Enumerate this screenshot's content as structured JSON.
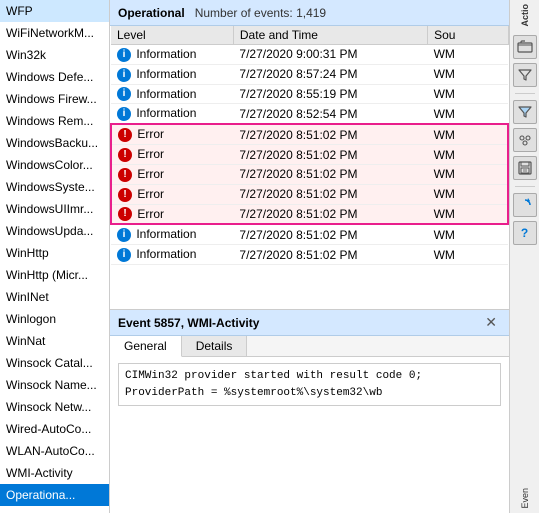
{
  "sidebar": {
    "items": [
      {
        "label": "WFP",
        "selected": false
      },
      {
        "label": "WiFiNetworkM...",
        "selected": false
      },
      {
        "label": "Win32k",
        "selected": false
      },
      {
        "label": "Windows Defe...",
        "selected": false
      },
      {
        "label": "Windows Firew...",
        "selected": false
      },
      {
        "label": "Windows Rem...",
        "selected": false
      },
      {
        "label": "WindowsBacku...",
        "selected": false
      },
      {
        "label": "WindowsColor...",
        "selected": false
      },
      {
        "label": "WindowsSyste...",
        "selected": false
      },
      {
        "label": "WindowsUIImr...",
        "selected": false
      },
      {
        "label": "WindowsUpda...",
        "selected": false
      },
      {
        "label": "WinHttp",
        "selected": false
      },
      {
        "label": "WinHttp (Micr...",
        "selected": false
      },
      {
        "label": "WinINet",
        "selected": false
      },
      {
        "label": "Winlogon",
        "selected": false
      },
      {
        "label": "WinNat",
        "selected": false
      },
      {
        "label": "Winsock Catal...",
        "selected": false
      },
      {
        "label": "Winsock Name...",
        "selected": false
      },
      {
        "label": "Winsock Netw...",
        "selected": false
      },
      {
        "label": "Wired-AutoCo...",
        "selected": false
      },
      {
        "label": "WLAN-AutoCo...",
        "selected": false
      },
      {
        "label": "WMI-Activity",
        "selected": false
      },
      {
        "label": "Operationa...",
        "selected": true
      }
    ]
  },
  "log": {
    "title": "Operational",
    "event_count": "Number of events: 1,419",
    "columns": [
      "Level",
      "Date and Time",
      "Sou"
    ],
    "rows": [
      {
        "type": "info",
        "level": "Information",
        "date": "7/27/2020 9:00:31 PM",
        "source": "WM"
      },
      {
        "type": "info",
        "level": "Information",
        "date": "7/27/2020 8:57:24 PM",
        "source": "WM"
      },
      {
        "type": "info",
        "level": "Information",
        "date": "7/27/2020 8:55:19 PM",
        "source": "WM"
      },
      {
        "type": "info",
        "level": "Information",
        "date": "7/27/2020 8:52:54 PM",
        "source": "WM"
      },
      {
        "type": "error",
        "level": "Error",
        "date": "7/27/2020 8:51:02 PM",
        "source": "WM"
      },
      {
        "type": "error",
        "level": "Error",
        "date": "7/27/2020 8:51:02 PM",
        "source": "WM"
      },
      {
        "type": "error",
        "level": "Error",
        "date": "7/27/2020 8:51:02 PM",
        "source": "WM"
      },
      {
        "type": "error",
        "level": "Error",
        "date": "7/27/2020 8:51:02 PM",
        "source": "WM"
      },
      {
        "type": "error",
        "level": "Error",
        "date": "7/27/2020 8:51:02 PM",
        "source": "WM"
      },
      {
        "type": "info",
        "level": "Information",
        "date": "7/27/2020 8:51:02 PM",
        "source": "WM"
      },
      {
        "type": "info",
        "level": "Information",
        "date": "7/27/2020 8:51:02 PM",
        "source": "WM"
      }
    ]
  },
  "event_panel": {
    "title": "Event 5857, WMI-Activity",
    "close_label": "✕",
    "tabs": [
      "General",
      "Details"
    ],
    "active_tab": "General",
    "content": "CIMWin32 provider started with result code 0;\nProviderPath = %systemroot%\\system32\\wb"
  },
  "actions": {
    "title": "Actio",
    "buttons": [
      {
        "label": "Ope",
        "icon": "📂"
      },
      {
        "label": "filter",
        "icon": "🔽"
      },
      {
        "label": "grp",
        "icon": "👥"
      },
      {
        "label": "save",
        "icon": "💾"
      },
      {
        "label": "ref",
        "icon": "🔄"
      },
      {
        "label": "help",
        "icon": "❓"
      }
    ],
    "event_label": "Even"
  }
}
